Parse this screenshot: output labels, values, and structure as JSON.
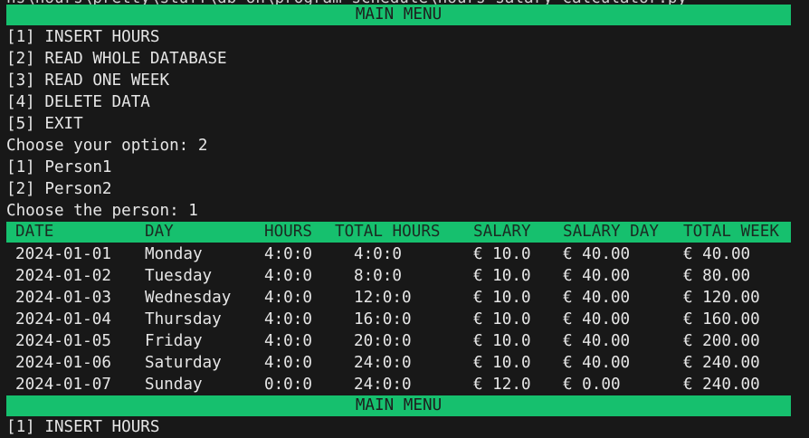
{
  "terminal": {
    "top_cut_text": "ns\\hours\\pretty\\stuff\\db_on\\program_schedule\\hours_salary_calculator.py",
    "menu_title": "MAIN MENU",
    "menu_items": [
      "[1] INSERT HOURS",
      "[2] READ WHOLE DATABASE",
      "[3] READ ONE WEEK",
      "[4] DELETE DATA",
      "[5] EXIT"
    ],
    "prompt_option": "Choose your option: 2",
    "person_items": [
      "[1] Person1",
      "[2] Person2"
    ],
    "prompt_person": "Choose the person: 1",
    "table": {
      "headers": [
        "DATE",
        "DAY",
        "HOURS",
        "TOTAL HOURS",
        "SALARY",
        "SALARY DAY",
        "TOTAL WEEK"
      ],
      "rows": [
        [
          "2024-01-01",
          "Monday",
          "4:0:0",
          "4:0:0",
          "€ 10.0",
          "€ 40.00",
          "€ 40.00"
        ],
        [
          "2024-01-02",
          "Tuesday",
          "4:0:0",
          "8:0:0",
          "€ 10.0",
          "€ 40.00",
          "€ 80.00"
        ],
        [
          "2024-01-03",
          "Wednesday",
          "4:0:0",
          "12:0:0",
          "€ 10.0",
          "€ 40.00",
          "€ 120.00"
        ],
        [
          "2024-01-04",
          "Thursday",
          "4:0:0",
          "16:0:0",
          "€ 10.0",
          "€ 40.00",
          "€ 160.00"
        ],
        [
          "2024-01-05",
          "Friday",
          "4:0:0",
          "20:0:0",
          "€ 10.0",
          "€ 40.00",
          "€ 200.00"
        ],
        [
          "2024-01-06",
          "Saturday",
          "4:0:0",
          "24:0:0",
          "€ 10.0",
          "€ 40.00",
          "€ 240.00"
        ],
        [
          "2024-01-07",
          "Sunday",
          "0:0:0",
          "24:0:0",
          "€ 12.0",
          "€ 0.00",
          "€ 240.00"
        ]
      ]
    },
    "bottom_menu_title": "MAIN MENU",
    "bottom_cut_text": "[1] INSERT HOURS"
  },
  "colors": {
    "background": "#181818",
    "text": "#e6e6e6",
    "highlight_bar": "#16c06e",
    "highlight_text": "#1e1e1e"
  }
}
